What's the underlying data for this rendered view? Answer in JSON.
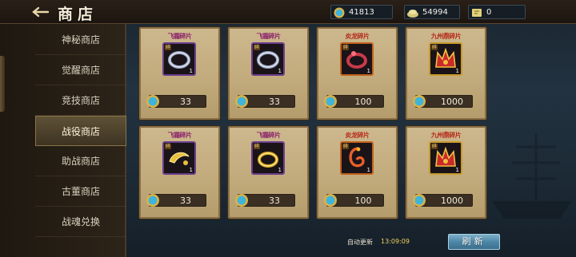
{
  "header": {
    "title": "商店",
    "currencies": [
      {
        "icon": "blue-gem-icon",
        "value": "41813"
      },
      {
        "icon": "money-icon",
        "value": "54994"
      },
      {
        "icon": "ticket-icon",
        "value": "0"
      }
    ]
  },
  "sidebar": {
    "items": [
      {
        "label": "神秘商店",
        "active": false
      },
      {
        "label": "觉醒商店",
        "active": false
      },
      {
        "label": "竞技商店",
        "active": false
      },
      {
        "label": "战役商店",
        "active": true
      },
      {
        "label": "助战商店",
        "active": false
      },
      {
        "label": "古董商店",
        "active": false
      },
      {
        "label": "战魂兑换",
        "active": false
      }
    ]
  },
  "items": [
    {
      "name": "飞霜碎片",
      "icon": "silver-ring-icon",
      "qty": "1",
      "price": "33",
      "frag": "碎"
    },
    {
      "name": "飞霜碎片",
      "icon": "silver-ring-icon",
      "qty": "1",
      "price": "33",
      "frag": "碎"
    },
    {
      "name": "炎龙碎片",
      "icon": "red-ring-icon",
      "qty": "1",
      "price": "100",
      "frag": "碎"
    },
    {
      "name": "九州鼎碎片",
      "icon": "red-crown-icon",
      "qty": "1",
      "price": "1000",
      "frag": "碎"
    },
    {
      "name": "飞霜碎片",
      "icon": "gold-bracelet-icon",
      "qty": "1",
      "price": "33",
      "frag": "碎"
    },
    {
      "name": "飞霜碎片",
      "icon": "gold-ring-icon",
      "qty": "1",
      "price": "33",
      "frag": "碎"
    },
    {
      "name": "炎龙碎片",
      "icon": "orange-dragon-ring-icon",
      "qty": "1",
      "price": "100",
      "frag": "碎"
    },
    {
      "name": "九州鼎碎片",
      "icon": "red-crown-icon",
      "qty": "1",
      "price": "1000",
      "frag": "碎"
    }
  ],
  "footer": {
    "auto_refresh_label": "自动更新",
    "auto_refresh_time": "13:09:09",
    "refresh_label": "刷新"
  },
  "colors": {
    "accent_blue": "#4d86a6",
    "card_bg": "#c2ab7c",
    "name_purple": "#8a1f6a",
    "name_red": "#b52a1c",
    "time_yellow": "#f4d25a"
  }
}
